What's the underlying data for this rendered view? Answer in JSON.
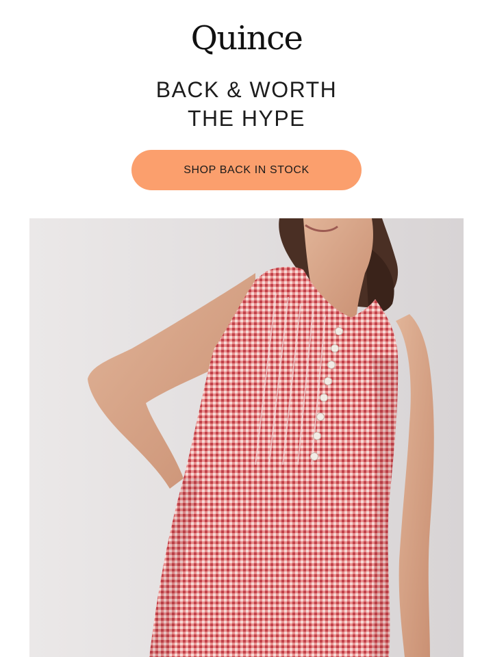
{
  "brand": {
    "logo_text": "Quince"
  },
  "hero": {
    "headline_line1": "BACK & WORTH",
    "headline_line2": "THE HYPE"
  },
  "cta": {
    "label": "SHOP BACK IN STOCK",
    "color": "#fb9f6d"
  },
  "image": {
    "subject": "model-in-red-gingham-sleeveless-dress"
  },
  "colors": {
    "background": "#ffffff",
    "text": "#1c1c1c",
    "dress": "#e0706f"
  }
}
